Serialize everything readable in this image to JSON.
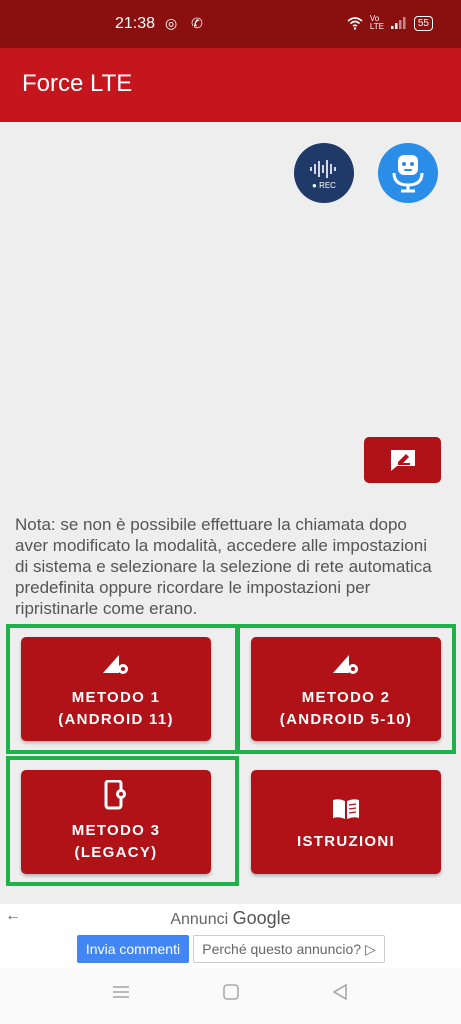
{
  "status": {
    "time": "21:38",
    "left_icons": "◎ ✆",
    "volte": "Vo LTE",
    "battery": "55"
  },
  "app": {
    "title": "Force LTE"
  },
  "fabs": {
    "rec_label": "● REC"
  },
  "note": "Nota: se non è possibile effettuare la chiamata dopo aver modificato la modalità, accedere alle impostazioni di sistema e selezionare la selezione di rete automatica predefinita oppure ricordare le impostazioni per ripristinarle come erano.",
  "buttons": [
    {
      "line1": "METODO 1",
      "line2": "(ANDROID 11)",
      "icon": "signal-gear-icon"
    },
    {
      "line1": "METODO 2",
      "line2": "(ANDROID 5-10)",
      "icon": "signal-gear-icon"
    },
    {
      "line1": "METODO 3",
      "line2": "(LEGACY)",
      "icon": "phone-settings-icon"
    },
    {
      "line1": "ISTRUZIONI",
      "line2": "",
      "icon": "book-icon"
    }
  ],
  "ad": {
    "prefix": "Annunci",
    "brand": "Google",
    "feedback": "Invia commenti",
    "why": "Perché questo annuncio? ▷"
  },
  "colors": {
    "primary": "#c4161c",
    "button": "#b01218",
    "status_bar": "#8a1010",
    "highlight": "#1fb14a"
  }
}
